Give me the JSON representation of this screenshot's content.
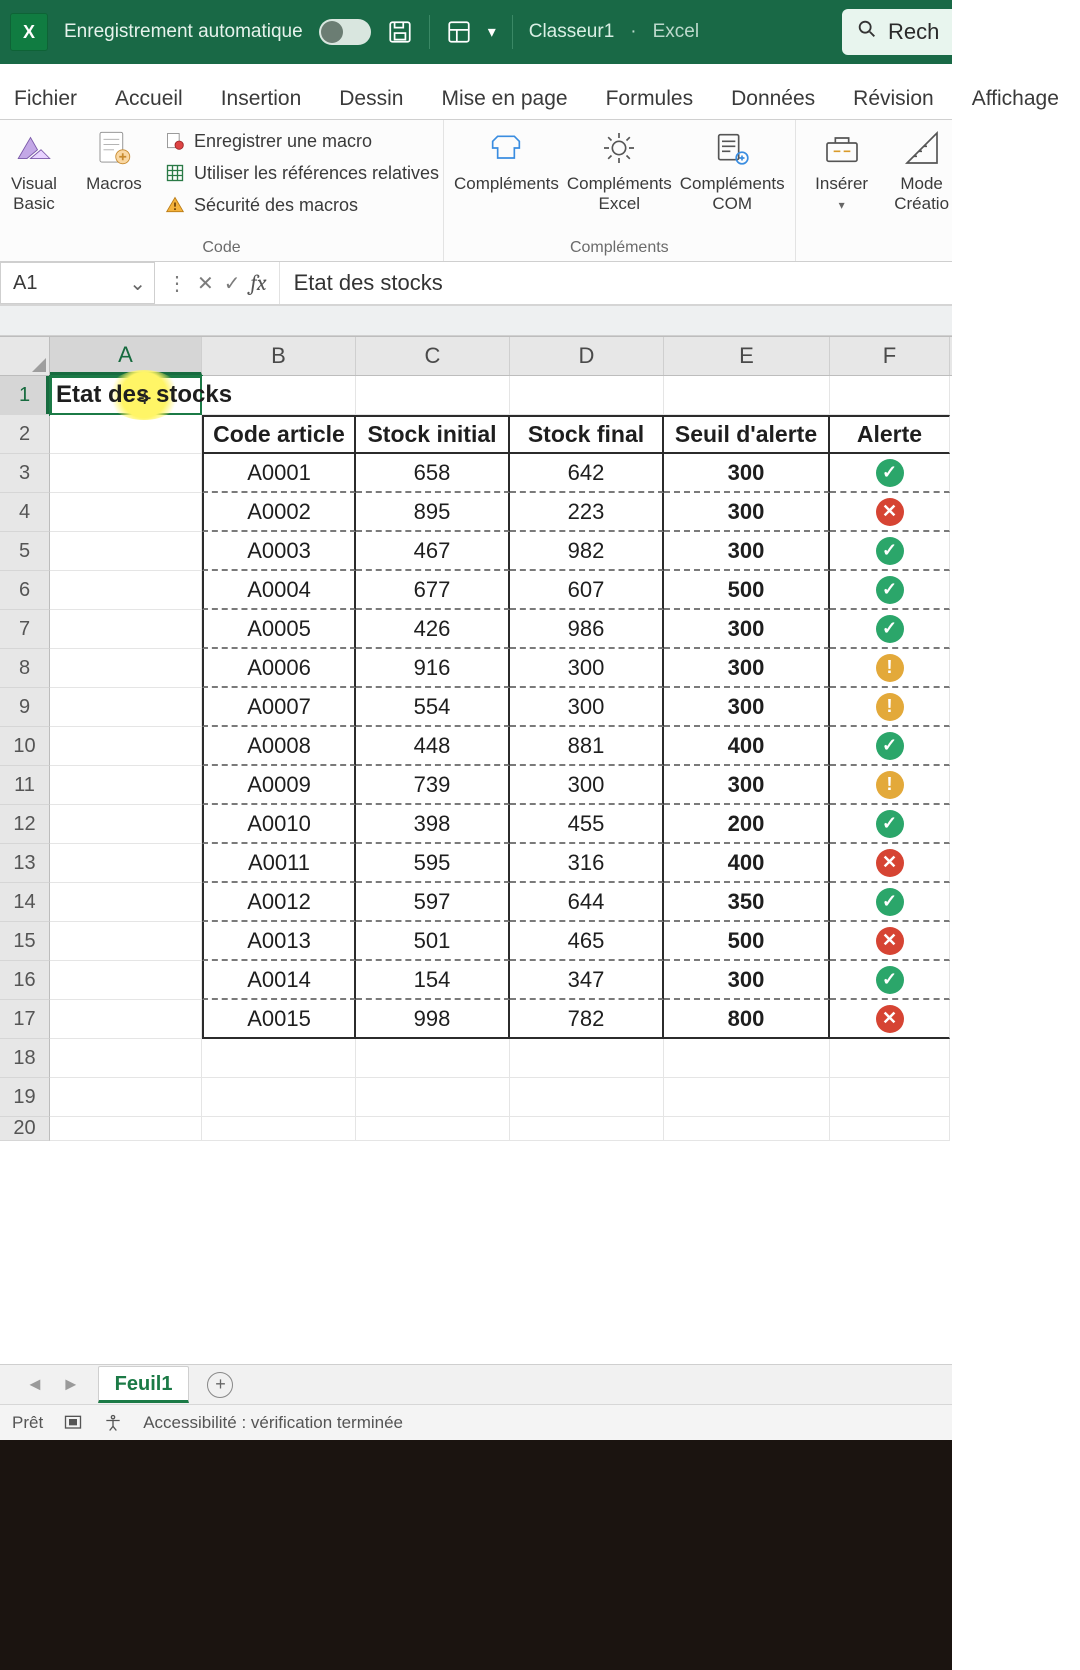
{
  "titlebar": {
    "auto_save_label": "Enregistrement automatique",
    "doc_title": "Classeur1",
    "sep": "·",
    "app_name": "Excel",
    "search_placeholder_prefix": "Rech"
  },
  "tabs": [
    "Fichier",
    "Accueil",
    "Insertion",
    "Dessin",
    "Mise en page",
    "Formules",
    "Données",
    "Révision",
    "Affichage"
  ],
  "ribbon": {
    "code": {
      "visual_basic": "Visual\nBasic",
      "macros": "Macros",
      "record": "Enregistrer une macro",
      "relative": "Utiliser les références relatives",
      "security": "Sécurité des macros",
      "group_label": "Code"
    },
    "addins": {
      "c1": "Compléments",
      "c2": "Compléments\nExcel",
      "c3": "Compléments\nCOM",
      "group_label": "Compléments"
    },
    "controls": {
      "insert": "Insérer",
      "design": "Mode\nCréatio"
    }
  },
  "namebox": {
    "cell_ref": "A1",
    "fx_label": "fx",
    "formula_value": "Etat des stocks"
  },
  "columns": [
    "A",
    "B",
    "C",
    "D",
    "E",
    "F"
  ],
  "row_numbers": [
    1,
    2,
    3,
    4,
    5,
    6,
    7,
    8,
    9,
    10,
    11,
    12,
    13,
    14,
    15,
    16,
    17,
    18,
    19,
    20
  ],
  "sheet": {
    "title_cell": "Etat des stocks",
    "headers": {
      "b": "Code article",
      "c": "Stock initial",
      "d": "Stock final",
      "e": "Seuil d'alerte",
      "f": "Alerte"
    }
  },
  "chart_data": {
    "type": "table",
    "rows": [
      {
        "code": "A0001",
        "init": 658,
        "final": 642,
        "seuil": 300,
        "alert": "ok"
      },
      {
        "code": "A0002",
        "init": 895,
        "final": 223,
        "seuil": 300,
        "alert": "bad"
      },
      {
        "code": "A0003",
        "init": 467,
        "final": 982,
        "seuil": 300,
        "alert": "ok"
      },
      {
        "code": "A0004",
        "init": 677,
        "final": 607,
        "seuil": 500,
        "alert": "ok"
      },
      {
        "code": "A0005",
        "init": 426,
        "final": 986,
        "seuil": 300,
        "alert": "ok"
      },
      {
        "code": "A0006",
        "init": 916,
        "final": 300,
        "seuil": 300,
        "alert": "warn"
      },
      {
        "code": "A0007",
        "init": 554,
        "final": 300,
        "seuil": 300,
        "alert": "warn"
      },
      {
        "code": "A0008",
        "init": 448,
        "final": 881,
        "seuil": 400,
        "alert": "ok"
      },
      {
        "code": "A0009",
        "init": 739,
        "final": 300,
        "seuil": 300,
        "alert": "warn"
      },
      {
        "code": "A0010",
        "init": 398,
        "final": 455,
        "seuil": 200,
        "alert": "ok"
      },
      {
        "code": "A0011",
        "init": 595,
        "final": 316,
        "seuil": 400,
        "alert": "bad"
      },
      {
        "code": "A0012",
        "init": 597,
        "final": 644,
        "seuil": 350,
        "alert": "ok"
      },
      {
        "code": "A0013",
        "init": 501,
        "final": 465,
        "seuil": 500,
        "alert": "bad"
      },
      {
        "code": "A0014",
        "init": 154,
        "final": 347,
        "seuil": 300,
        "alert": "ok"
      },
      {
        "code": "A0015",
        "init": 998,
        "final": 782,
        "seuil": 800,
        "alert": "bad"
      }
    ]
  },
  "sheet_tabs": {
    "active": "Feuil1"
  },
  "statusbar": {
    "ready": "Prêt",
    "accessibility": "Accessibilité : vérification terminée"
  }
}
